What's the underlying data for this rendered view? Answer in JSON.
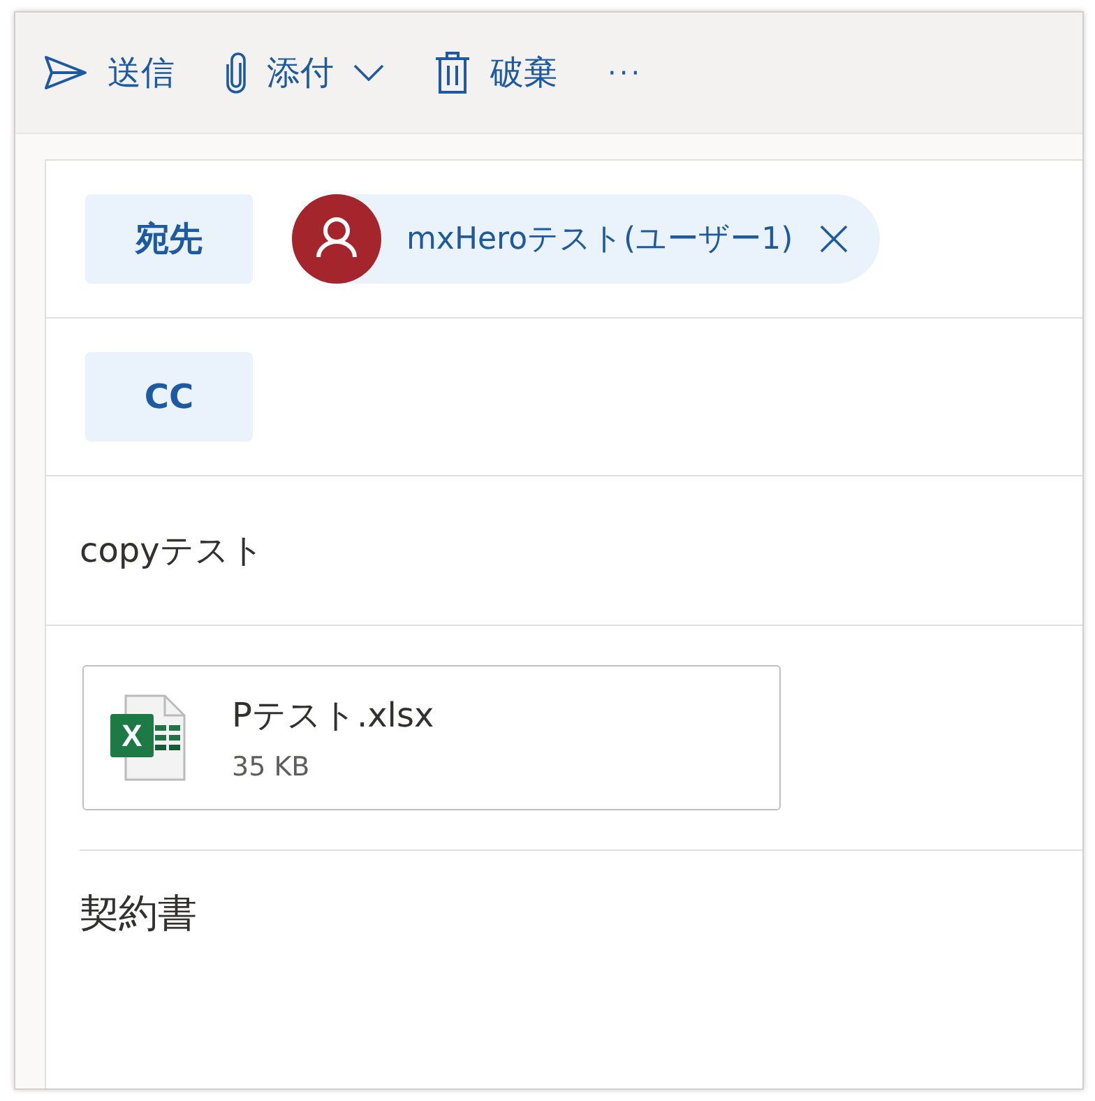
{
  "toolbar": {
    "items": [
      {
        "kind": "send",
        "label": "送信"
      },
      {
        "kind": "attach",
        "label": "添付"
      },
      {
        "kind": "discard",
        "label": "破棄"
      },
      {
        "kind": "more",
        "label": "···"
      }
    ]
  },
  "to": {
    "label": "宛先",
    "recipients": [
      {
        "name": "mxHeroテスト(ユーザー1)",
        "color": "#a4262c"
      }
    ]
  },
  "cc": {
    "label": "CC"
  },
  "subject": {
    "value": "copyテスト"
  },
  "attachments": [
    {
      "name": "Pテスト.xlsx",
      "size": "35 KB",
      "icon_letter": "X"
    }
  ],
  "body": {
    "text": "契約書"
  }
}
